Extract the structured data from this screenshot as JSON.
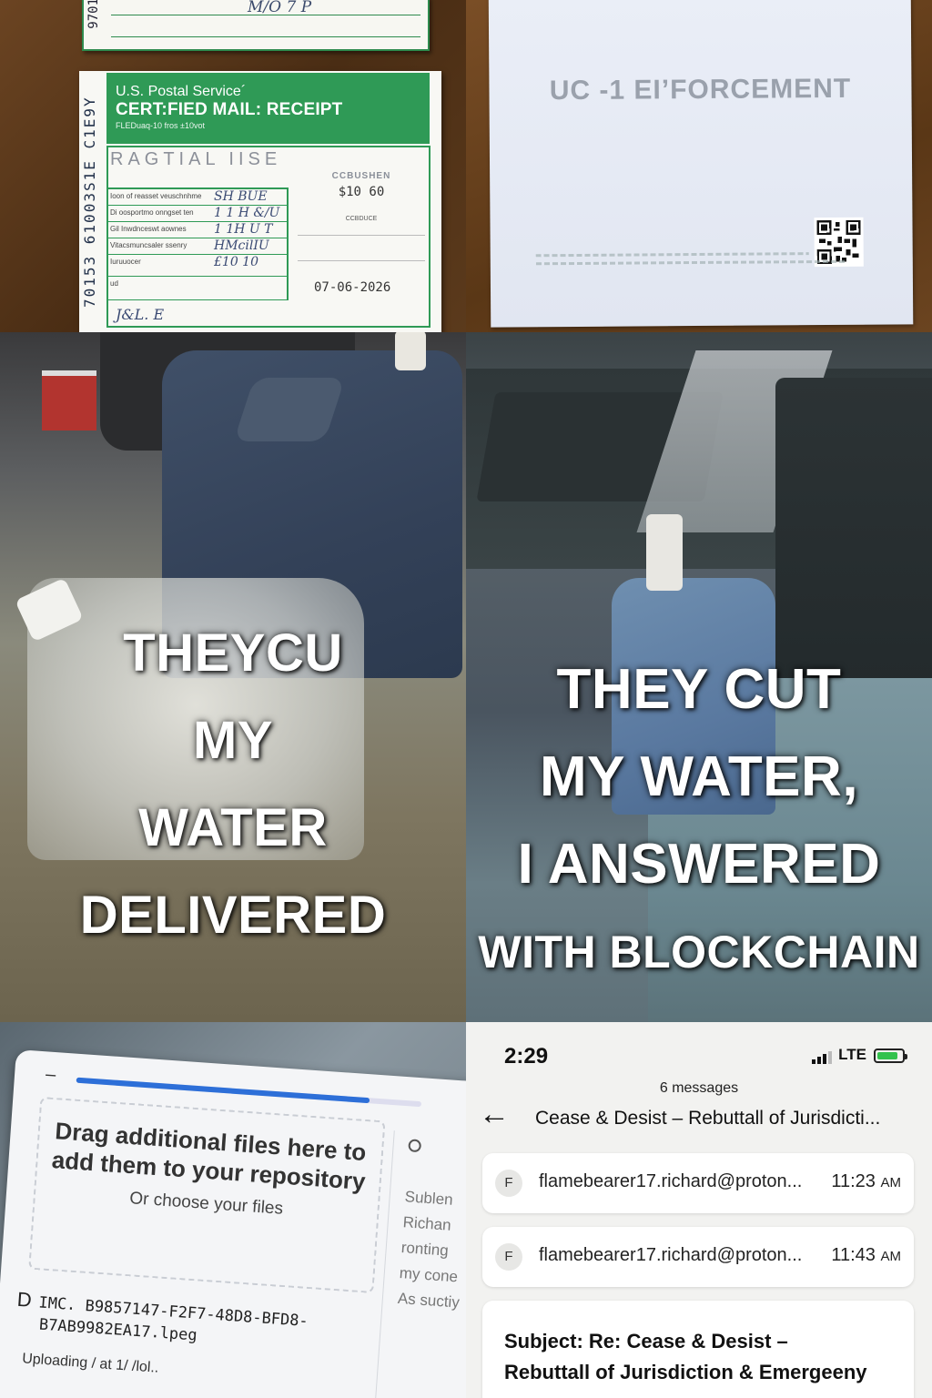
{
  "receipt": {
    "side_top": "9701",
    "top_scrawl": "M/O  7  P",
    "side_code": "70153  61003S1E  C1E9Y",
    "header_line1": "U.S. Postal Service´",
    "header_line2": "CERT:FIED MAIL: RECEIPT",
    "header_line3": "FLEDuaq-10 fros ±10vot",
    "banner": "RAGTIAL  IISE",
    "right_label": "CCBUSHEN",
    "amount": "$10 60",
    "right_label2": "CCBDUCE",
    "rows": [
      {
        "label": "Ioon of reasset veuschnhme",
        "hand": "SH BUE"
      },
      {
        "label": "Di oosportmo onngset ten",
        "hand": "1 1 H &/U"
      },
      {
        "label": "Gil Inwdnceswt aownes",
        "hand": "1 1H U T"
      },
      {
        "label": "Vitacsmuncsaler ssenry",
        "hand": "HMcilIU"
      },
      {
        "label": "Iuruuocer",
        "hand": "£10 10"
      },
      {
        "label": "ud",
        "hand": ""
      }
    ],
    "date": "07-06-2026",
    "bottom_hand": "J&L. E"
  },
  "letter": {
    "title": "UC ‑1 EI’FORCEMENT"
  },
  "jug_panel": {
    "lines": [
      "THEYCU",
      "MY",
      "WATER",
      "DELIVERED"
    ]
  },
  "car_panel": {
    "lines": [
      "THEY CUT",
      "MY WATER,",
      "I ANSWERED",
      "WITH BLOCKCHAIN"
    ]
  },
  "upload": {
    "dropzone_title": "Drag additional files here to add them to your repository",
    "dropzone_sub": "Or choose your files",
    "side_items": [
      "Sublen",
      "Richan",
      "ronting",
      "my cone",
      "As suctiy"
    ],
    "file_icon": "D",
    "file_name_1": "IMC. B9857147-F2F7-48D8-BFD8-",
    "file_name_2": "B7AB9982EA17.lpeg",
    "uploading": "Uploading / at 1/ /lol.."
  },
  "mail": {
    "time": "2:29",
    "network": "LTE",
    "battery_level": 0.85,
    "accent": "#33c24d",
    "message_count": "6 messages",
    "back_icon": "arrow-left-icon",
    "subject": "Cease & Desist – Rebuttall of Jurisdicti...",
    "messages": [
      {
        "avatar": "F",
        "from": "flamebearer17.richard@proton...",
        "time": "11:23",
        "ampm": "AM"
      },
      {
        "avatar": "F",
        "from": "flamebearer17.richard@proton...",
        "time": "11:43",
        "ampm": "AM"
      }
    ],
    "open_line1": "Subject: Re: Cease & Desist –",
    "open_line2": "Rebuttall of Jurisdiction & Emergeeny"
  }
}
